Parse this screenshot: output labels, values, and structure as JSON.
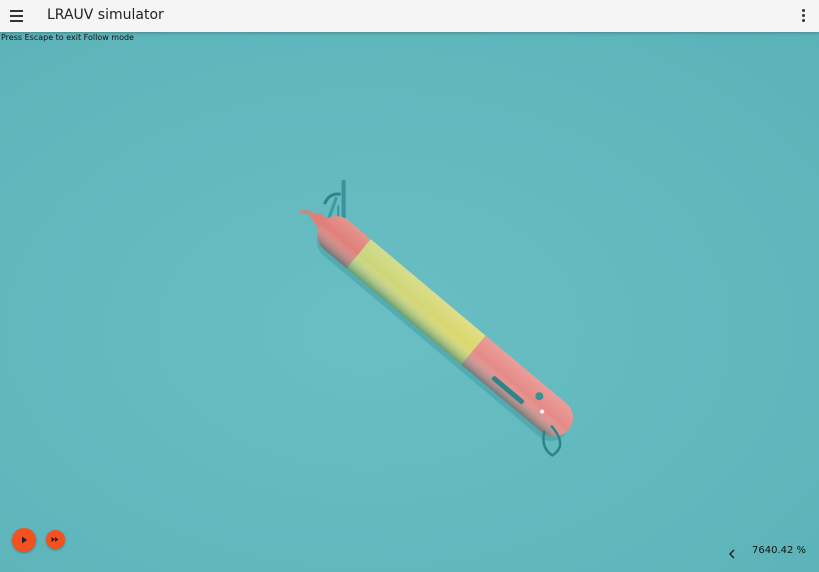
{
  "app": {
    "title": "LRAUV simulator",
    "background_color": "#5fb6bb",
    "header_color": "#f5f5f5"
  },
  "toolbar": {
    "menu_icon": "hamburger-menu-icon",
    "more_icon": "more-vert-icon"
  },
  "viewport": {
    "hint": "Press Escape to exit Follow mode",
    "vehicle_colors": {
      "nose": "#e07f78",
      "mid": "#d9d86e",
      "tail": "#e58a86",
      "fins": "#3f9aa0"
    }
  },
  "playback": {
    "play_icon": "play-icon",
    "fast_forward_icon": "fast-forward-icon",
    "button_color": "#f4511e",
    "collapse_icon": "chevron-left-icon",
    "speed": "7640.42 %"
  }
}
